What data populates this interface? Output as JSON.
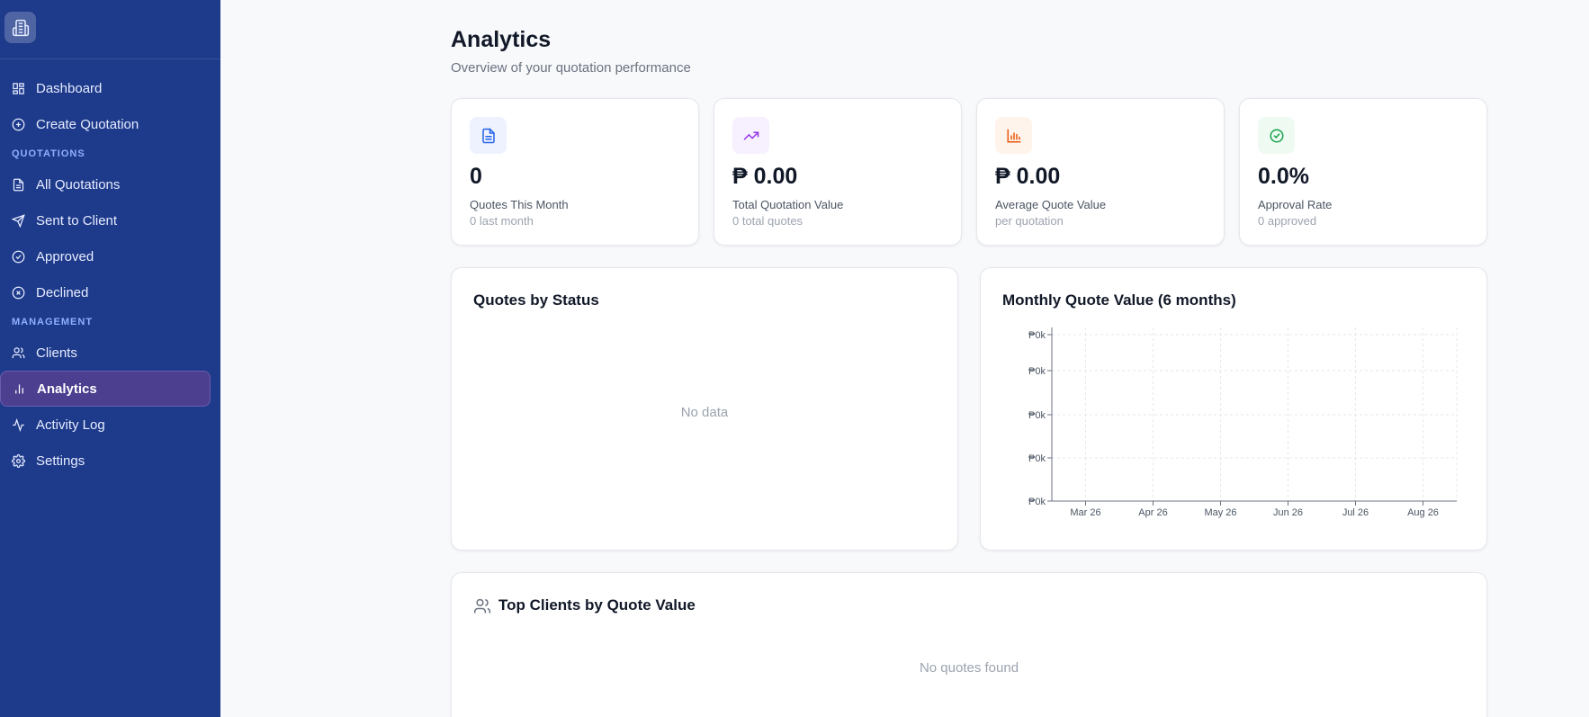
{
  "sidebar": {
    "logo_icon": "building-icon",
    "nav_top": [
      {
        "label": "Dashboard",
        "icon": "dashboard-icon"
      },
      {
        "label": "Create Quotation",
        "icon": "plus-circle-icon"
      }
    ],
    "section_quotations": "QUOTATIONS",
    "nav_quotations": [
      {
        "label": "All Quotations",
        "icon": "document-icon"
      },
      {
        "label": "Sent to Client",
        "icon": "send-icon"
      },
      {
        "label": "Approved",
        "icon": "check-circle-icon"
      },
      {
        "label": "Declined",
        "icon": "x-circle-icon"
      }
    ],
    "section_management": "MANAGEMENT",
    "nav_management": [
      {
        "label": "Clients",
        "icon": "users-icon"
      },
      {
        "label": "Analytics",
        "icon": "bar-chart-icon",
        "active": true
      },
      {
        "label": "Activity Log",
        "icon": "activity-icon"
      },
      {
        "label": "Settings",
        "icon": "gear-icon"
      }
    ]
  },
  "header": {
    "title": "Analytics",
    "subtitle": "Overview of your quotation performance"
  },
  "stats": [
    {
      "value": "0",
      "label": "Quotes This Month",
      "sub": "0 last month",
      "icon": "document-icon",
      "color": "#2563eb",
      "bg": "#eef2ff"
    },
    {
      "value": "₱ 0.00",
      "label": "Total Quotation Value",
      "sub": "0 total quotes",
      "icon": "trending-up-icon",
      "color": "#9333ea",
      "bg": "#f7f0ff"
    },
    {
      "value": "₱ 0.00",
      "label": "Average Quote Value",
      "sub": "per quotation",
      "icon": "bar-chart-icon",
      "color": "#ea580c",
      "bg": "#fff4ec"
    },
    {
      "value": "0.0%",
      "label": "Approval Rate",
      "sub": "0 approved",
      "icon": "check-circle-icon",
      "color": "#16a34a",
      "bg": "#effaf2"
    }
  ],
  "status_panel": {
    "title": "Quotes by Status",
    "empty": "No data"
  },
  "monthly_panel": {
    "title": "Monthly Quote Value (6 months)"
  },
  "top_clients": {
    "title": "Top Clients by Quote Value",
    "icon": "users-icon",
    "empty": "No quotes found"
  },
  "chart_data": {
    "type": "line",
    "title": "Monthly Quote Value (6 months)",
    "categories": [
      "Mar 26",
      "Apr 26",
      "May 26",
      "Jun 26",
      "Jul 26",
      "Aug 26"
    ],
    "values": [
      0,
      0,
      0,
      0,
      0,
      0
    ],
    "y_tick_labels": [
      "₱0k",
      "₱0k",
      "₱0k",
      "₱0k",
      "₱0k"
    ],
    "grid": true,
    "gridline_color": "#e5e7eb"
  }
}
